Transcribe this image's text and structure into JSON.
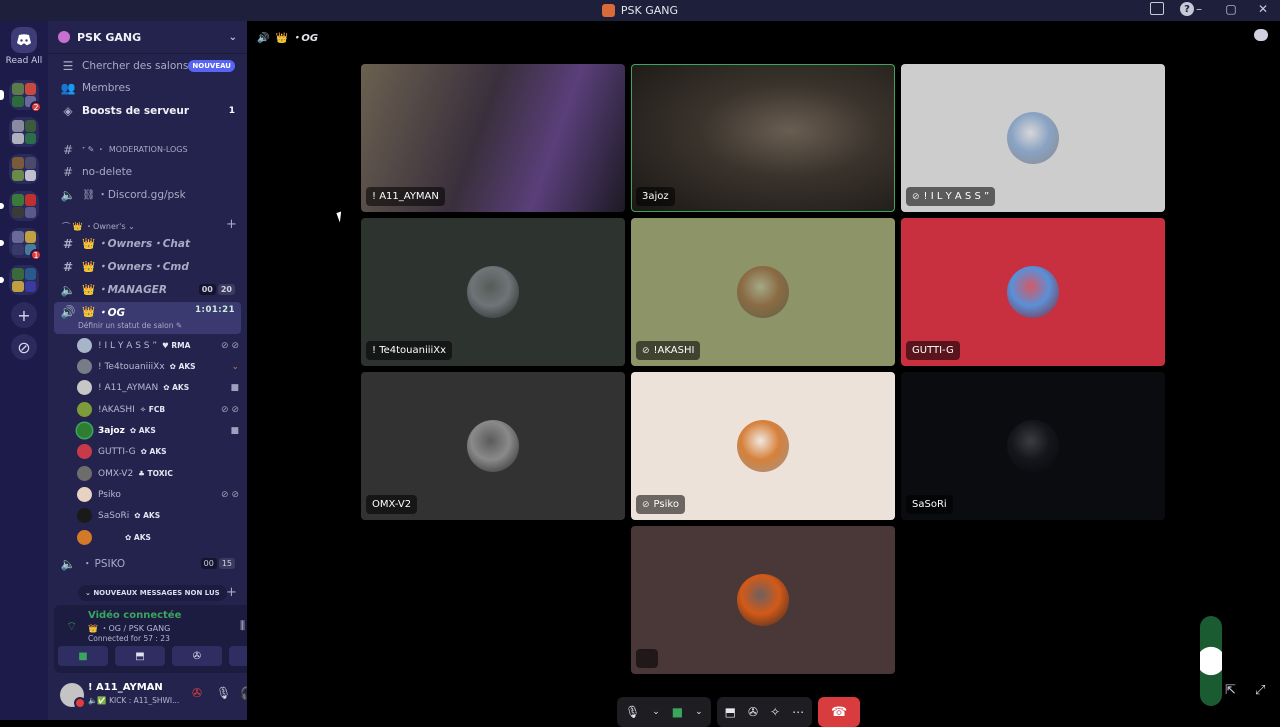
{
  "window": {
    "title": "PSK GANG"
  },
  "rail": {
    "read_all": "Read All",
    "badges": [
      "2",
      "1"
    ]
  },
  "guild": {
    "name": "PSK GANG"
  },
  "nav": {
    "browse": {
      "label": "Chercher des salons",
      "tag": "NOUVEAU"
    },
    "members": {
      "label": "Membres"
    },
    "boosts": {
      "label": "Boosts de serveur",
      "count": "1"
    }
  },
  "channels": {
    "moderation_logs": "MODERATION-LOGS",
    "no_delete": "no-delete",
    "discord_link": "・Discord.gg/psk",
    "category_owner": "Owner's",
    "owners_chat": "・Owners・Chat",
    "owners_cmd": "・Owners・Cmd",
    "manager": "・MANAGER",
    "manager_counts": [
      "00",
      "20"
    ],
    "og": "・OG",
    "og_timer": "1:01:21",
    "og_status": "Définir un statut de salon",
    "psiko": "PSIKO",
    "psiko_counts": [
      "00",
      "15"
    ]
  },
  "voice_members": [
    {
      "name": "! I L Y A S S ”",
      "badge": "RMA",
      "avatar_color": "#a8b5c9"
    },
    {
      "name": "! Te4touaniiiXx",
      "badge": "AKS",
      "avatar_color": "#777d86"
    },
    {
      "name": "! A11_AYMAN",
      "badge": "AKS",
      "avatar_color": "#c7c7c7"
    },
    {
      "name": "!AKASHI",
      "badge": "FCB",
      "avatar_color": "#7e9b3a"
    },
    {
      "name": "3ajoz",
      "badge": "AKS",
      "avatar_color": "#2f7d32"
    },
    {
      "name": "GUTTI-G",
      "badge": "AKS",
      "avatar_color": "#c83a4a"
    },
    {
      "name": "OMX-V2",
      "badge": "TOXIC",
      "avatar_color": "#6d6d6d"
    },
    {
      "name": "Psiko",
      "badge": "",
      "avatar_color": "#e8d2c2"
    },
    {
      "name": "SaSoRi",
      "badge": "AKS",
      "avatar_color": "#1a1a1a"
    },
    {
      "name": "",
      "badge": "AKS",
      "avatar_color": "#d27a2a"
    }
  ],
  "unread_pill": "NOUVEAUX MESSAGES NON LUS",
  "voice_panel": {
    "title": "Vidéo connectée",
    "channel": "・OG / PSK GANG",
    "connected_for": "Connected for 57 : 23"
  },
  "user": {
    "name": "! A11_AYMAN",
    "status": "KICK : A11_SHWI..."
  },
  "main": {
    "channel_title": "・OG"
  },
  "tiles": [
    {
      "label": "! A11_AYMAN",
      "type": "video",
      "bg": "#3a3340"
    },
    {
      "label": "3ajoz",
      "type": "video",
      "bg": "#2a2622"
    },
    {
      "label": "! I L Y A S S ”",
      "type": "avatar",
      "bg": "#cdcdcd",
      "avatar_color": "#8aa3c4",
      "muted": true
    },
    {
      "label": "! Te4touaniiiXx",
      "type": "avatar",
      "bg": "#2d332f",
      "avatar_color": "#6f7478"
    },
    {
      "label": "!AKASHI",
      "type": "avatar",
      "bg": "#8c9468",
      "avatar_color": "#8b6b44",
      "muted": true
    },
    {
      "label": "GUTTI-G",
      "type": "avatar",
      "bg": "#c8303f",
      "avatar_color": "#5a90d8"
    },
    {
      "label": "OMX-V2",
      "type": "avatar",
      "bg": "#323232",
      "avatar_color": "#8a8a8a"
    },
    {
      "label": "Psiko",
      "type": "avatar",
      "bg": "#ede2d9",
      "avatar_color": "#d6803a",
      "muted": true
    },
    {
      "label": "SaSoRi",
      "type": "avatar",
      "bg": "#0a0c10",
      "avatar_color": "#14161c"
    },
    {
      "label": "",
      "type": "avatar",
      "bg": "#4a3838",
      "avatar_color": "#d35a18"
    }
  ],
  "colors": {
    "accent": "#5865f2",
    "connected": "#3ba55d",
    "hangup": "#d83c3e",
    "sidebar": "#24234d"
  }
}
